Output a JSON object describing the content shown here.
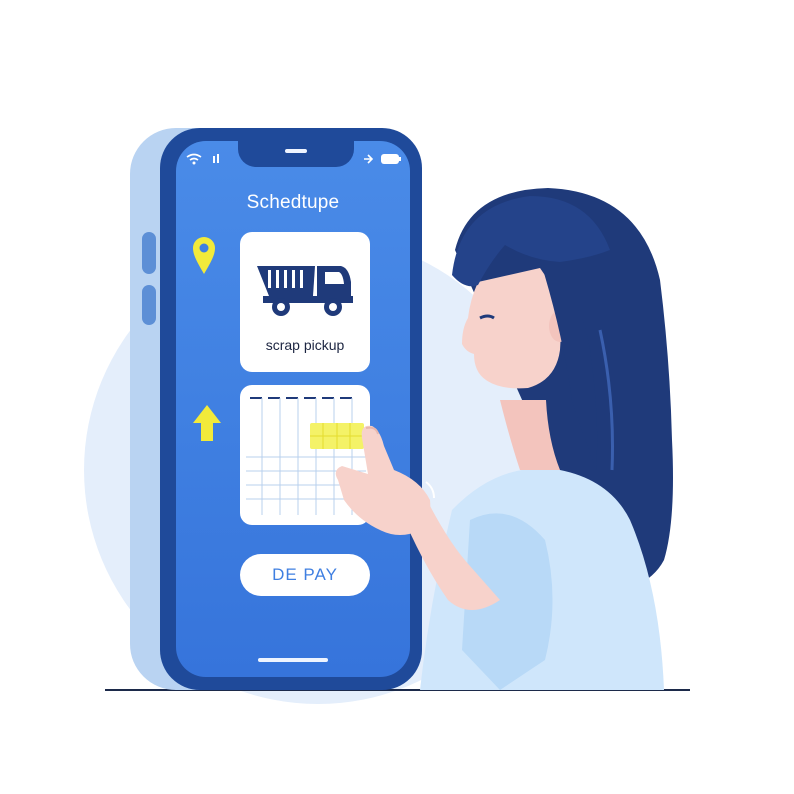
{
  "app": {
    "title": "Schedtupe"
  },
  "pickup_card": {
    "label": "scrap pickup",
    "icon": "dump-truck-icon"
  },
  "calendar": {
    "highlight_color": "#f4f267"
  },
  "pay_button": {
    "label": "DE PAY"
  },
  "icons": {
    "location": "location-pin-icon",
    "upload": "up-arrow-icon",
    "wifi": "wifi-icon",
    "battery": "battery-icon"
  },
  "colors": {
    "screen_blue": "#3f7fe1",
    "phone_frame": "#1f4a9a",
    "accent_yellow": "#f2ea3a",
    "hair_navy": "#1f3a7a",
    "shirt": "#cfe6fb",
    "skin": "#f7d2cb"
  }
}
